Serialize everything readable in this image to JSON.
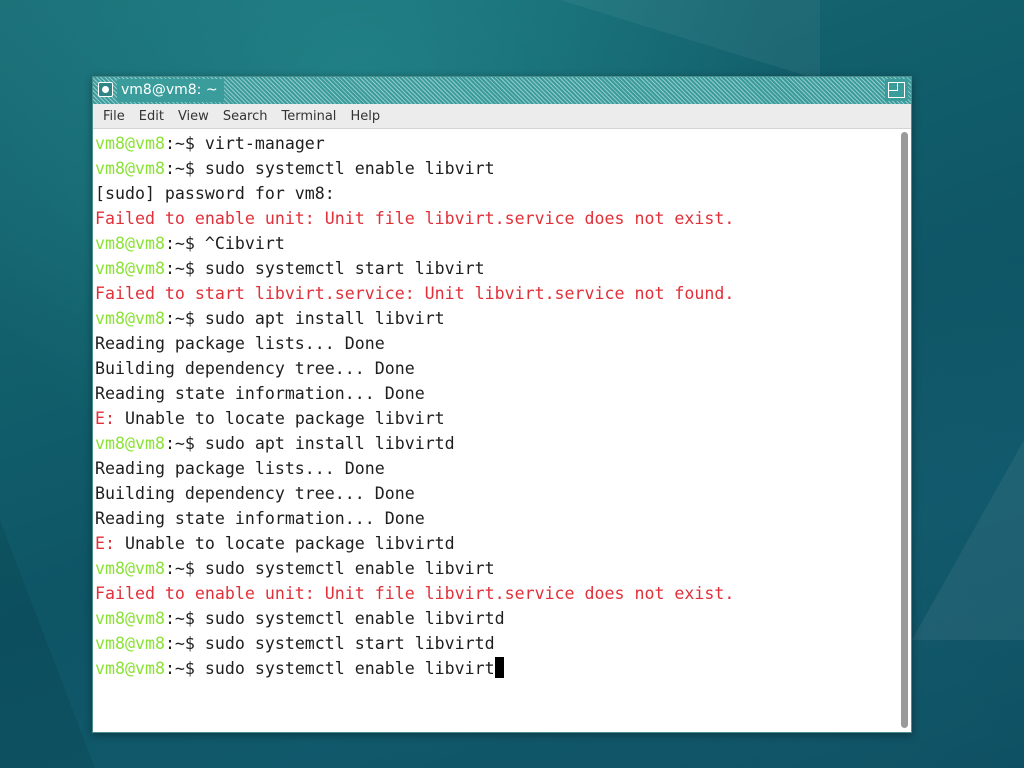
{
  "window": {
    "title": "vm8@vm8: ~",
    "menu_icon": "terminal-window-menu-icon",
    "maximize_icon": "maximize-icon"
  },
  "menubar": {
    "items": [
      "File",
      "Edit",
      "View",
      "Search",
      "Terminal",
      "Help"
    ]
  },
  "colors": {
    "prompt": "#8ae234",
    "error": "#e0303a",
    "text": "#1e1e1e",
    "titlebar": "#3b9c9c"
  },
  "terminal": {
    "lines": [
      [
        {
          "t": "vm8@vm8",
          "c": "prompt"
        },
        {
          "t": ":~$ ",
          "c": "sep"
        },
        {
          "t": "virt-manager",
          "c": "text"
        }
      ],
      [
        {
          "t": "vm8@vm8",
          "c": "prompt"
        },
        {
          "t": ":~$ ",
          "c": "sep"
        },
        {
          "t": "sudo systemctl enable libvirt",
          "c": "text"
        }
      ],
      [
        {
          "t": "[sudo] password for vm8:",
          "c": "text"
        }
      ],
      [
        {
          "t": "Failed to enable unit: Unit file libvirt.service does not exist.",
          "c": "error"
        }
      ],
      [
        {
          "t": "vm8@vm8",
          "c": "prompt"
        },
        {
          "t": ":~$ ",
          "c": "sep"
        },
        {
          "t": "^Cibvirt",
          "c": "text"
        }
      ],
      [
        {
          "t": "vm8@vm8",
          "c": "prompt"
        },
        {
          "t": ":~$ ",
          "c": "sep"
        },
        {
          "t": "sudo systemctl start libvirt",
          "c": "text"
        }
      ],
      [
        {
          "t": "Failed to start libvirt.service: Unit libvirt.service not found.",
          "c": "error"
        }
      ],
      [
        {
          "t": "vm8@vm8",
          "c": "prompt"
        },
        {
          "t": ":~$ ",
          "c": "sep"
        },
        {
          "t": "sudo apt install libvirt",
          "c": "text"
        }
      ],
      [
        {
          "t": "Reading package lists... Done",
          "c": "text"
        }
      ],
      [
        {
          "t": "Building dependency tree... Done",
          "c": "text"
        }
      ],
      [
        {
          "t": "Reading state information... Done",
          "c": "text"
        }
      ],
      [
        {
          "t": "E: ",
          "c": "error"
        },
        {
          "t": "Unable to locate package libvirt",
          "c": "text"
        }
      ],
      [
        {
          "t": "vm8@vm8",
          "c": "prompt"
        },
        {
          "t": ":~$ ",
          "c": "sep"
        },
        {
          "t": "sudo apt install libvirtd",
          "c": "text"
        }
      ],
      [
        {
          "t": "Reading package lists... Done",
          "c": "text"
        }
      ],
      [
        {
          "t": "Building dependency tree... Done",
          "c": "text"
        }
      ],
      [
        {
          "t": "Reading state information... Done",
          "c": "text"
        }
      ],
      [
        {
          "t": "E: ",
          "c": "error"
        },
        {
          "t": "Unable to locate package libvirtd",
          "c": "text"
        }
      ],
      [
        {
          "t": "vm8@vm8",
          "c": "prompt"
        },
        {
          "t": ":~$ ",
          "c": "sep"
        },
        {
          "t": "sudo systemctl enable libvirt",
          "c": "text"
        }
      ],
      [
        {
          "t": "Failed to enable unit: Unit file libvirt.service does not exist.",
          "c": "error"
        }
      ],
      [
        {
          "t": "vm8@vm8",
          "c": "prompt"
        },
        {
          "t": ":~$ ",
          "c": "sep"
        },
        {
          "t": "sudo systemctl enable libvirtd",
          "c": "text"
        }
      ],
      [
        {
          "t": "vm8@vm8",
          "c": "prompt"
        },
        {
          "t": ":~$ ",
          "c": "sep"
        },
        {
          "t": "sudo systemctl start libvirtd",
          "c": "text"
        }
      ],
      [
        {
          "t": "vm8@vm8",
          "c": "prompt"
        },
        {
          "t": ":~$ ",
          "c": "sep"
        },
        {
          "t": "sudo systemctl enable libvirt",
          "c": "text"
        }
      ]
    ],
    "cursor_on_last_line": true
  }
}
